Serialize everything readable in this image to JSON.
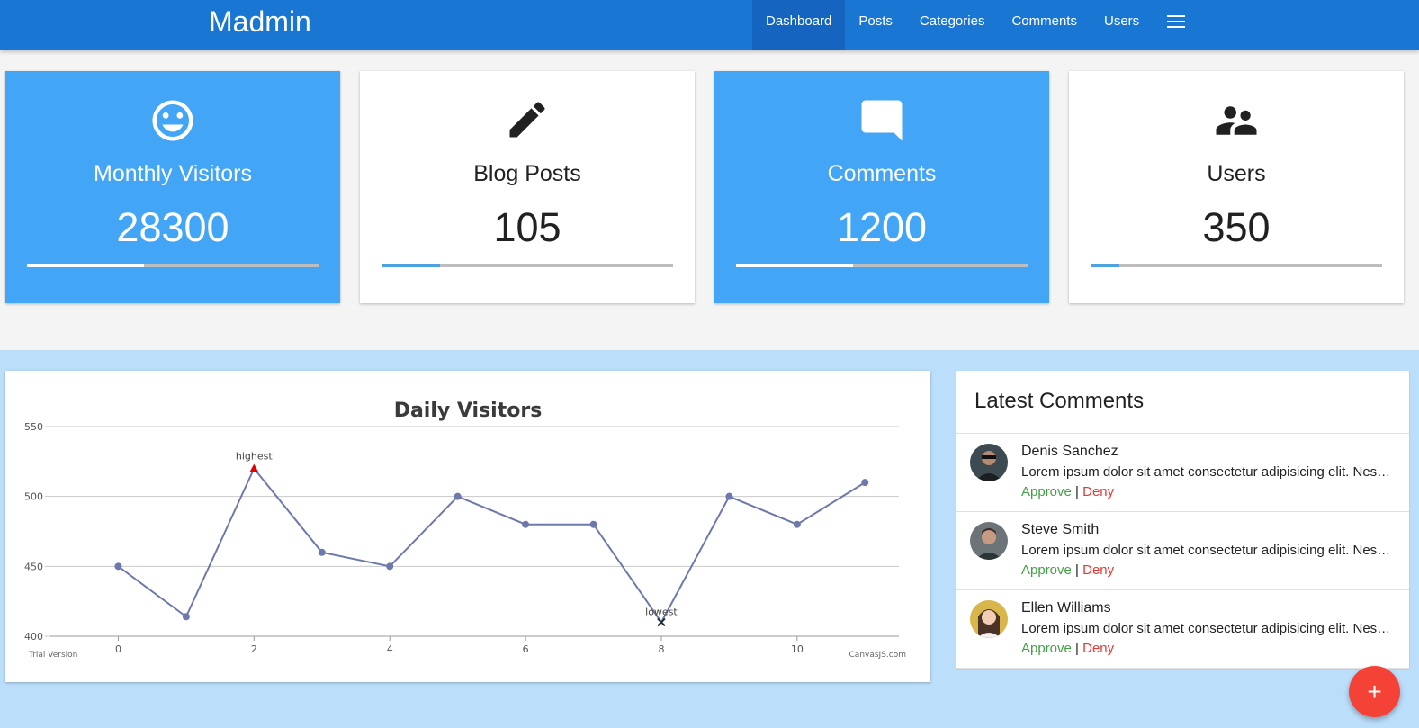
{
  "navbar": {
    "brand": "Madmin",
    "links": [
      "Dashboard",
      "Posts",
      "Categories",
      "Comments",
      "Users"
    ],
    "active": "Dashboard",
    "menu_icon": "hamburger-menu-icon"
  },
  "stats": [
    {
      "title": "Monthly Visitors",
      "value": "28300",
      "icon": "smiley-face-icon",
      "progress": 0.4,
      "style": "blue"
    },
    {
      "title": "Blog Posts",
      "value": "105",
      "icon": "pencil-icon",
      "progress": 0.2,
      "style": "white"
    },
    {
      "title": "Comments",
      "value": "1200",
      "icon": "comment-bubble-icon",
      "progress": 0.4,
      "style": "blue"
    },
    {
      "title": "Users",
      "value": "350",
      "icon": "people-icon",
      "progress": 0.1,
      "style": "white"
    }
  ],
  "chart_data": {
    "type": "line",
    "title": "Daily Visitors",
    "x": [
      0,
      1,
      2,
      3,
      4,
      5,
      6,
      7,
      8,
      9,
      10,
      11
    ],
    "values": [
      450,
      414,
      520,
      460,
      450,
      500,
      480,
      480,
      410,
      500,
      480,
      510
    ],
    "xlim": [
      -1,
      11.5
    ],
    "ylim": [
      400,
      550
    ],
    "xticks": [
      0,
      2,
      4,
      6,
      8,
      10
    ],
    "yticks": [
      400,
      450,
      500,
      550
    ],
    "grid": true,
    "annotations": [
      {
        "x": 2,
        "label": "highest"
      },
      {
        "x": 8,
        "label": "lowest"
      }
    ],
    "footer_left": "Trial Version",
    "footer_right": "CanvasJS.com",
    "colors": {
      "line": "#6d78ad",
      "highest": "#e60000",
      "lowest": "#1f2a36"
    }
  },
  "comments": {
    "title": "Latest Comments",
    "approve_label": "Approve",
    "deny_label": "Deny",
    "separator": "|",
    "items": [
      {
        "name": "Denis Sanchez",
        "text": "Lorem ipsum dolor sit amet consectetur adipisicing elit. Nesciunt, voluptatum.",
        "avatar_color": "#3d4a52"
      },
      {
        "name": "Steve Smith",
        "text": "Lorem ipsum dolor sit amet consectetur adipisicing elit. Nesciunt, voluptatum.",
        "avatar_color": "#6d7478"
      },
      {
        "name": "Ellen Williams",
        "text": "Lorem ipsum dolor sit amet consectetur adipisicing elit. Nesciunt, voluptatum.",
        "avatar_color": "#d8b64a"
      }
    ]
  },
  "fab": {
    "label": "+",
    "icon": "plus-icon"
  },
  "colors": {
    "primary": "#1976d2",
    "card_blue": "#42a5f5",
    "accent": "#f44336",
    "approve": "#43a047",
    "deny": "#e53935"
  }
}
